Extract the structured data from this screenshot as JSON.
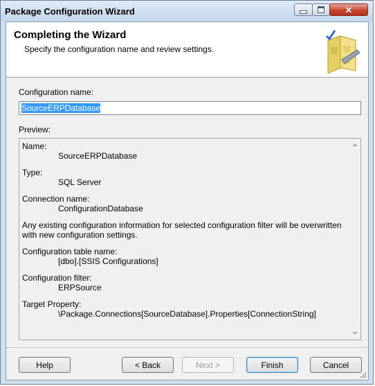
{
  "window": {
    "title": "Package Configuration Wizard"
  },
  "header": {
    "title": "Completing the Wizard",
    "subtitle": "Specify the configuration name and review settings."
  },
  "config_name": {
    "label": "Configuration name:",
    "value": "SourceERPDatabase"
  },
  "preview": {
    "label": "Preview:",
    "name_label": "Name:",
    "name_value": "SourceERPDatabase",
    "type_label": "Type:",
    "type_value": "SQL Server",
    "connection_label": "Connection name:",
    "connection_value": "ConfigurationDatabase",
    "warning": "Any existing configuration information for selected configuration filter will be overwritten with new configuration settings.",
    "table_label": "Configuration table name:",
    "table_value": "[dbo].[SSIS Configurations]",
    "filter_label": "Configuration filter:",
    "filter_value": "ERPSource",
    "target_label": "Target Property:",
    "target_value": "\\Package.Connections[SourceDatabase].Properties[ConnectionString]"
  },
  "buttons": {
    "help": "Help",
    "back": "< Back",
    "next": "Next >",
    "finish": "Finish",
    "cancel": "Cancel"
  },
  "colors": {
    "title_bar": "#c3d6ec",
    "close_button": "#c7462e",
    "selection": "#3399ff",
    "dialog_background": "#f0f0f0"
  },
  "icons": [
    "minimize-icon",
    "maximize-icon",
    "close-icon",
    "wizard-puzzle-icon",
    "scroll-up-icon",
    "scroll-down-icon",
    "resize-grip-icon"
  ]
}
